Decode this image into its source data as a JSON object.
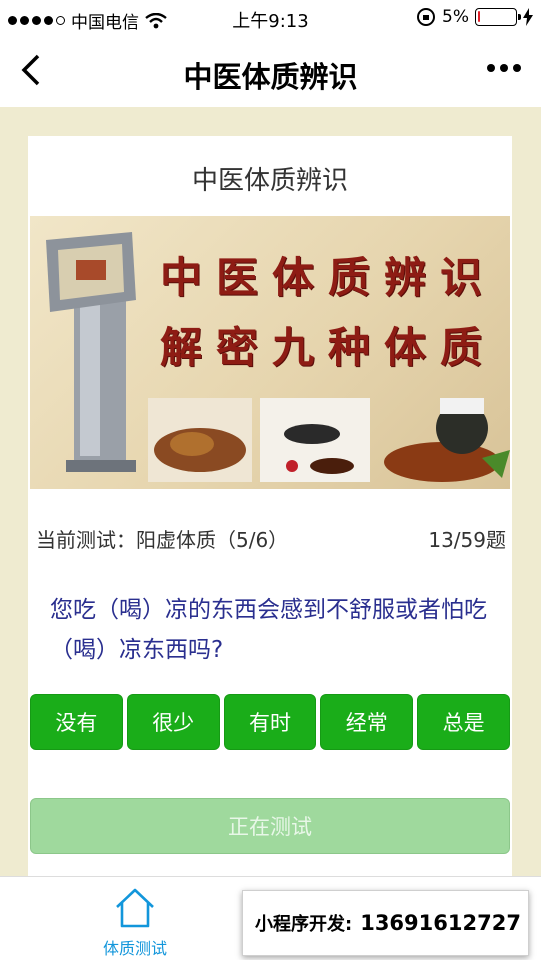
{
  "status_bar": {
    "carrier": "中国电信",
    "time": "上午9:13",
    "battery_percent": "5%",
    "battery_level": 0.05,
    "signal_bars": 4
  },
  "nav": {
    "title": "中医体质辨识"
  },
  "card": {
    "title": "中医体质辨识",
    "banner": {
      "line1": "中医体质辨识",
      "line2": "解密九种体质"
    },
    "progress": {
      "current_label": "当前测试：阳虚体质（5/6）",
      "count": "13/59题"
    },
    "question": "您吃（喝）凉的东西会感到不舒服或者怕吃（喝）凉东西吗?",
    "options": [
      "没有",
      "很少",
      "有时",
      "经常",
      "总是"
    ],
    "status_button": "正在测试"
  },
  "tabbar": {
    "home_label": "体质测试"
  },
  "ad": {
    "label": "小程序开发:",
    "phone": "13691612727"
  },
  "colors": {
    "accent_green": "#1aad19",
    "question_text": "#2a2f8f",
    "tab_blue": "#1296db",
    "background": "#efebd0"
  }
}
